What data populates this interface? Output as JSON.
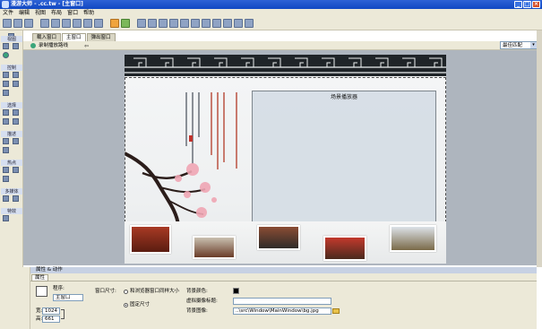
{
  "window": {
    "title": "漫游大师 - .cc.tw - [主窗口]"
  },
  "menu": [
    "文件",
    "编辑",
    "视图",
    "布局",
    "窗口",
    "帮助"
  ],
  "left_panel": {
    "sections": [
      "视图",
      "控制",
      "选择",
      "描述",
      "热点",
      "多媒体",
      "特效"
    ]
  },
  "tabs": [
    "载入窗口",
    "主窗口",
    "弹出窗口"
  ],
  "active_tab": "主窗口",
  "subtoolbar": {
    "label": "录制播放路线"
  },
  "match_select": {
    "value": "最佳匹配"
  },
  "stage": {
    "player_label": "场景播放器"
  },
  "properties": {
    "header": "属性 & 动作",
    "tab": "属性",
    "window_label": "程序:",
    "window_name": "主窗口",
    "width_label": "宽:",
    "width_value": "1024",
    "height_label": "高:",
    "height_value": "661",
    "size_label": "窗口尺寸:",
    "option_resize": "和浏览器窗口同样大小",
    "option_fixed": "固定尺寸",
    "bg_color_label": "背景颜色:",
    "vscene_label": "虚拟摄像标题:",
    "bg_image_label": "背景图像:",
    "bg_image_path": "..\\src\\Window\\MainWindow\\bg.jpg"
  },
  "colors": {
    "titlebar": "#1148c2",
    "panel": "#ece9d8",
    "canvas": "#aeb5be"
  }
}
